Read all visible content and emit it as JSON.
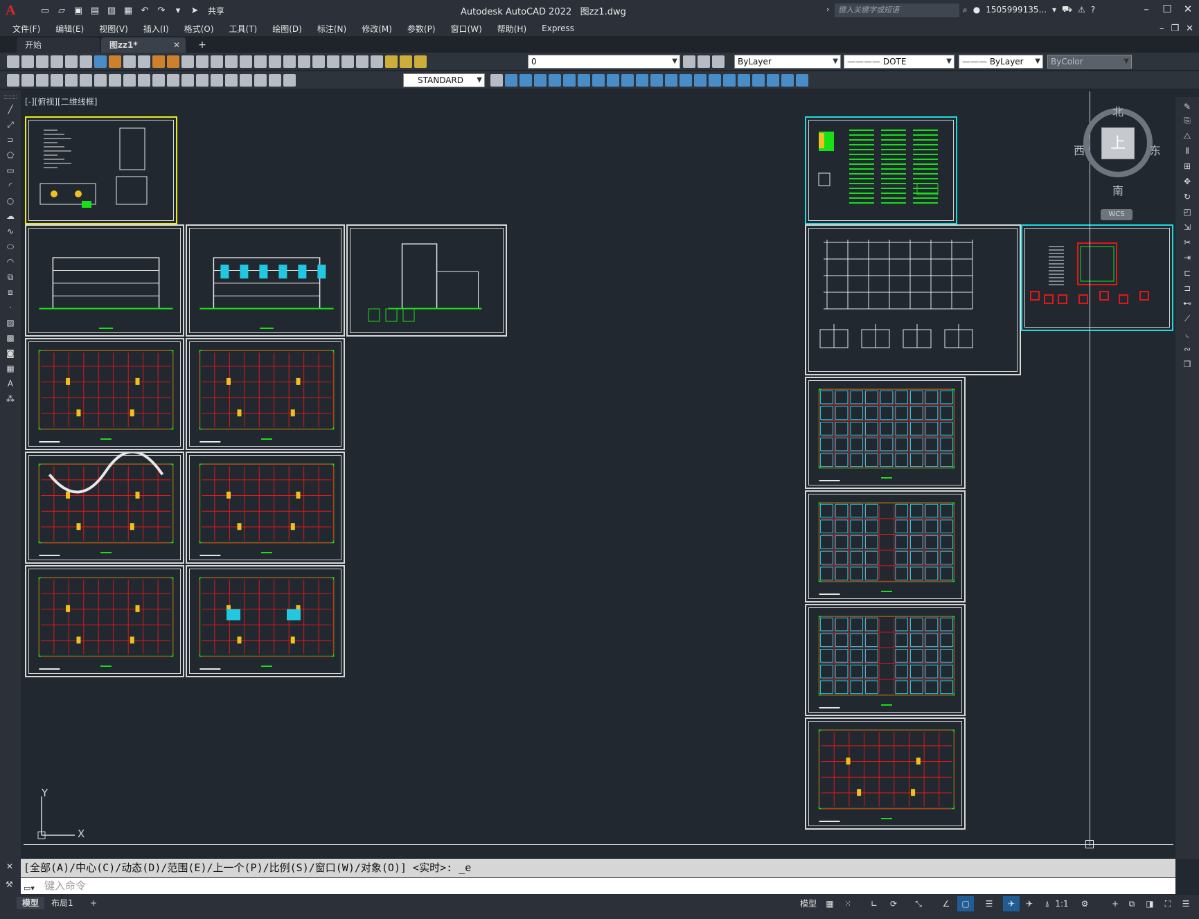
{
  "app": {
    "title": "Autodesk AutoCAD 2022",
    "file": "图zz1.dwg",
    "share_label": "共享",
    "search_placeholder": "键入关键字或短语",
    "user": "1505999135...",
    "logo_letter": "A"
  },
  "menu": [
    "文件(F)",
    "编辑(E)",
    "视图(V)",
    "插入(I)",
    "格式(O)",
    "工具(T)",
    "绘图(D)",
    "标注(N)",
    "修改(M)",
    "参数(P)",
    "窗口(W)",
    "帮助(H)",
    "Express"
  ],
  "tabs": {
    "start": "开始",
    "file": "图zz1*",
    "plus": "+"
  },
  "toolbar": {
    "layer": "0",
    "color": "ByLayer",
    "linetype": "DOTE",
    "lineweight": "ByLayer",
    "plotstyle": "ByColor",
    "textstyle": "STANDARD"
  },
  "viewport": {
    "label": "[-][俯视][二维线框]"
  },
  "viewcube": {
    "top": "上",
    "north": "北",
    "south": "南",
    "east": "东",
    "west": "西",
    "wcs": "WCS"
  },
  "ucs": {
    "x": "X",
    "y": "Y"
  },
  "command": {
    "history": "[全部(A)/中心(C)/动态(D)/范围(E)/上一个(P)/比例(S)/窗口(W)/对象(O)] <实时>: _e",
    "placeholder": "键入命令"
  },
  "layouts": [
    "模型",
    "布局1"
  ],
  "status": {
    "model": "模型",
    "scale": "1:1"
  },
  "colors": {
    "background": "#212830",
    "frame": "#d8d8d8",
    "selected_yellow": "#ecec14",
    "selected_cyan": "#1fd9e0",
    "grid_red": "#e01818",
    "outline_green": "#18e018",
    "column_yellow": "#f0c020",
    "fill_cyan": "#22c8e0"
  }
}
